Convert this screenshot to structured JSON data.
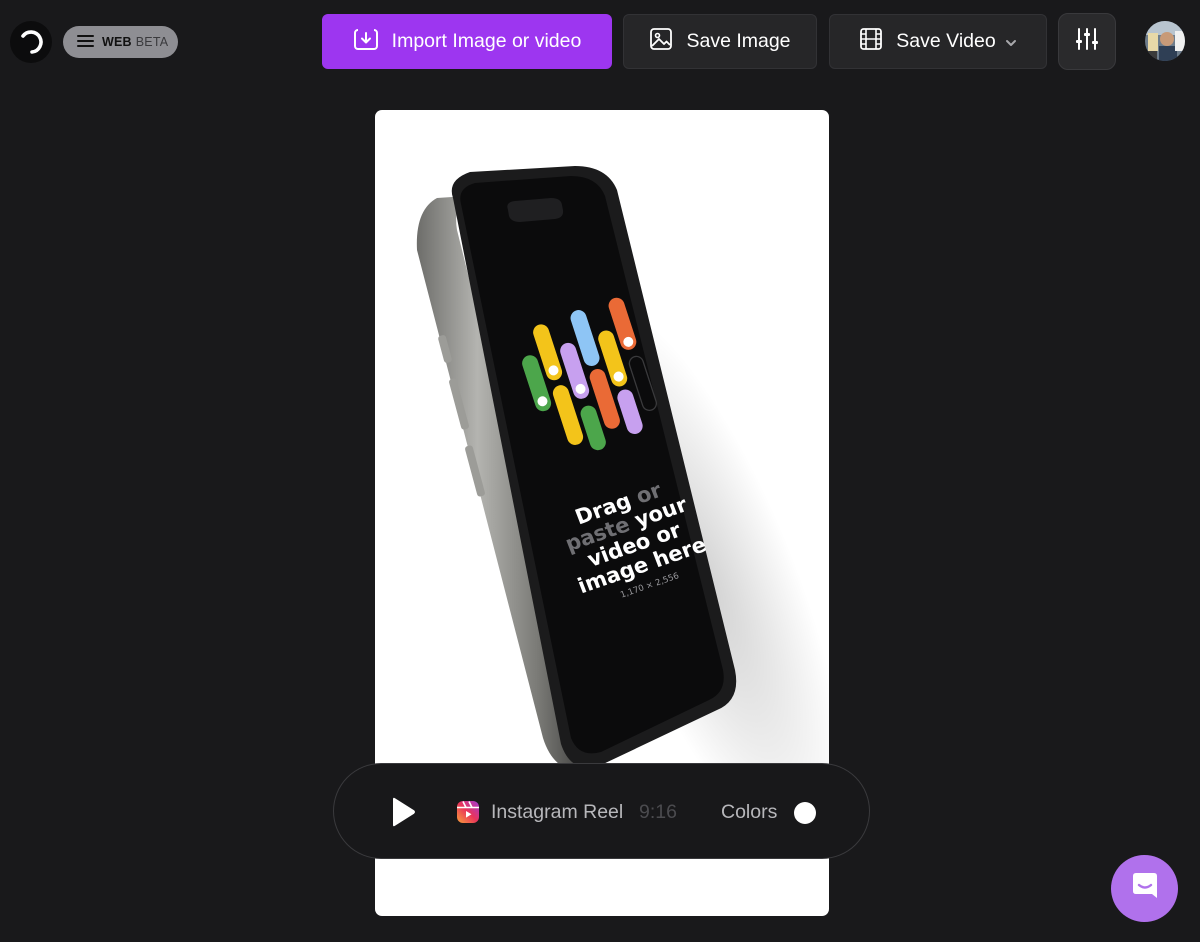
{
  "header": {
    "menu": {
      "label": "WEB",
      "badge": "BETA"
    },
    "import_button": "Import Image or video",
    "save_image_button": "Save Image",
    "save_video_button": "Save Video",
    "icons": {
      "logo": "logo-icon",
      "menu": "hamburger-icon",
      "import": "import-icon",
      "save_image": "image-icon",
      "save_video": "film-icon",
      "dropdown": "chevron-down-icon",
      "settings": "sliders-icon",
      "avatar": "user-avatar"
    }
  },
  "canvas": {
    "drop_text": {
      "line1_a": "Drag",
      "line1_b": "or",
      "line2_a": "paste",
      "line2_b": "your",
      "line3": "video or",
      "line4": "image here"
    },
    "dimensions": "1,170 × 2,556"
  },
  "controls": {
    "format_label": "Instagram Reel",
    "format_ratio": "9:16",
    "colors_label": "Colors",
    "icons": {
      "play": "play-icon",
      "format": "instagram-reels-icon",
      "swatch": "color-swatch"
    }
  },
  "chat": {
    "icon": "chat-icon"
  },
  "colors": {
    "background": "#19191b",
    "accent": "#9d36f0",
    "button_bg": "#262628",
    "chat_fab": "#b071ec",
    "canvas_bg": "#ffffff",
    "phone_frame": "#8a8a86",
    "phone_screen": "#0b0b0c"
  }
}
